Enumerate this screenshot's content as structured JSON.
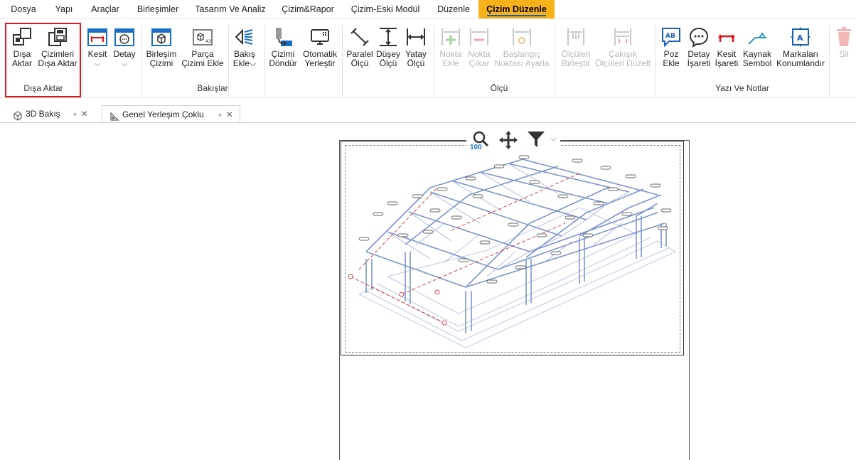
{
  "menu": {
    "items": [
      "Dosya",
      "Yapı",
      "Araçlar",
      "Birleşimler",
      "Tasarım Ve Analiz",
      "Çizim&Rapor",
      "Çizim-Eski Modül",
      "Düzenle",
      "Çizim Düzenle"
    ],
    "active_index": 8
  },
  "ribbon": {
    "groups": {
      "export": "Dışa Aktar",
      "views": "Bakışlar",
      "dimension": "Ölçü",
      "text_notes": "Yazı Ve Notlar"
    },
    "buttons": {
      "export_label": [
        "Dışa",
        "Aktar"
      ],
      "export_drawings": [
        "Çizimleri",
        "Dışa Aktar"
      ],
      "section": [
        "Kesit"
      ],
      "detail": [
        "Detay"
      ],
      "connection_drawing": [
        "Birleşim",
        "Çizimi"
      ],
      "add_part_drawing": [
        "Parça",
        "Çizimi Ekle"
      ],
      "add_view": [
        "Bakış",
        "Ekle"
      ],
      "rotate_drawing": [
        "Çizimi",
        "Döndür"
      ],
      "auto_place": [
        "Otomatik",
        "Yerleştir"
      ],
      "parallel_dim": [
        "Paralel",
        "Ölçü"
      ],
      "vertical_dim": [
        "Düşey",
        "Ölçü"
      ],
      "horizontal_dim": [
        "Yatay",
        "Ölçü"
      ],
      "add_point": [
        "Nokta",
        "Ekle"
      ],
      "remove_point": [
        "Nokta",
        "Çıkar"
      ],
      "set_start": [
        "Başlangıç",
        "Noktası Ayarla"
      ],
      "merge_dims": [
        "Ölçüleri",
        "Birleştir"
      ],
      "fix_overlaps": [
        "Çakışık",
        "Ölçüleri Düzelt"
      ],
      "position_tag": [
        "Poz",
        "Ekle"
      ],
      "detail_mark": [
        "Detay",
        "İşareti"
      ],
      "section_mark": [
        "Kesit",
        "İşareti"
      ],
      "weld_symbol": [
        "Kaynak",
        "Sembol"
      ],
      "place_marks": [
        "Markaları",
        "Konumlandır"
      ],
      "delete": [
        "Sil"
      ]
    }
  },
  "tabs": [
    {
      "label": "3D Bakış"
    },
    {
      "label": "Genel Yerleşim Çoklu"
    }
  ],
  "view_toolbar": {
    "zoom_level": "100"
  },
  "colors": {
    "accent": "#f7b21b",
    "highlight": "#e0141b",
    "icon_blue": "#1a6fc4",
    "icon_red": "#e0141b",
    "disabled": "#b8b8b8"
  }
}
